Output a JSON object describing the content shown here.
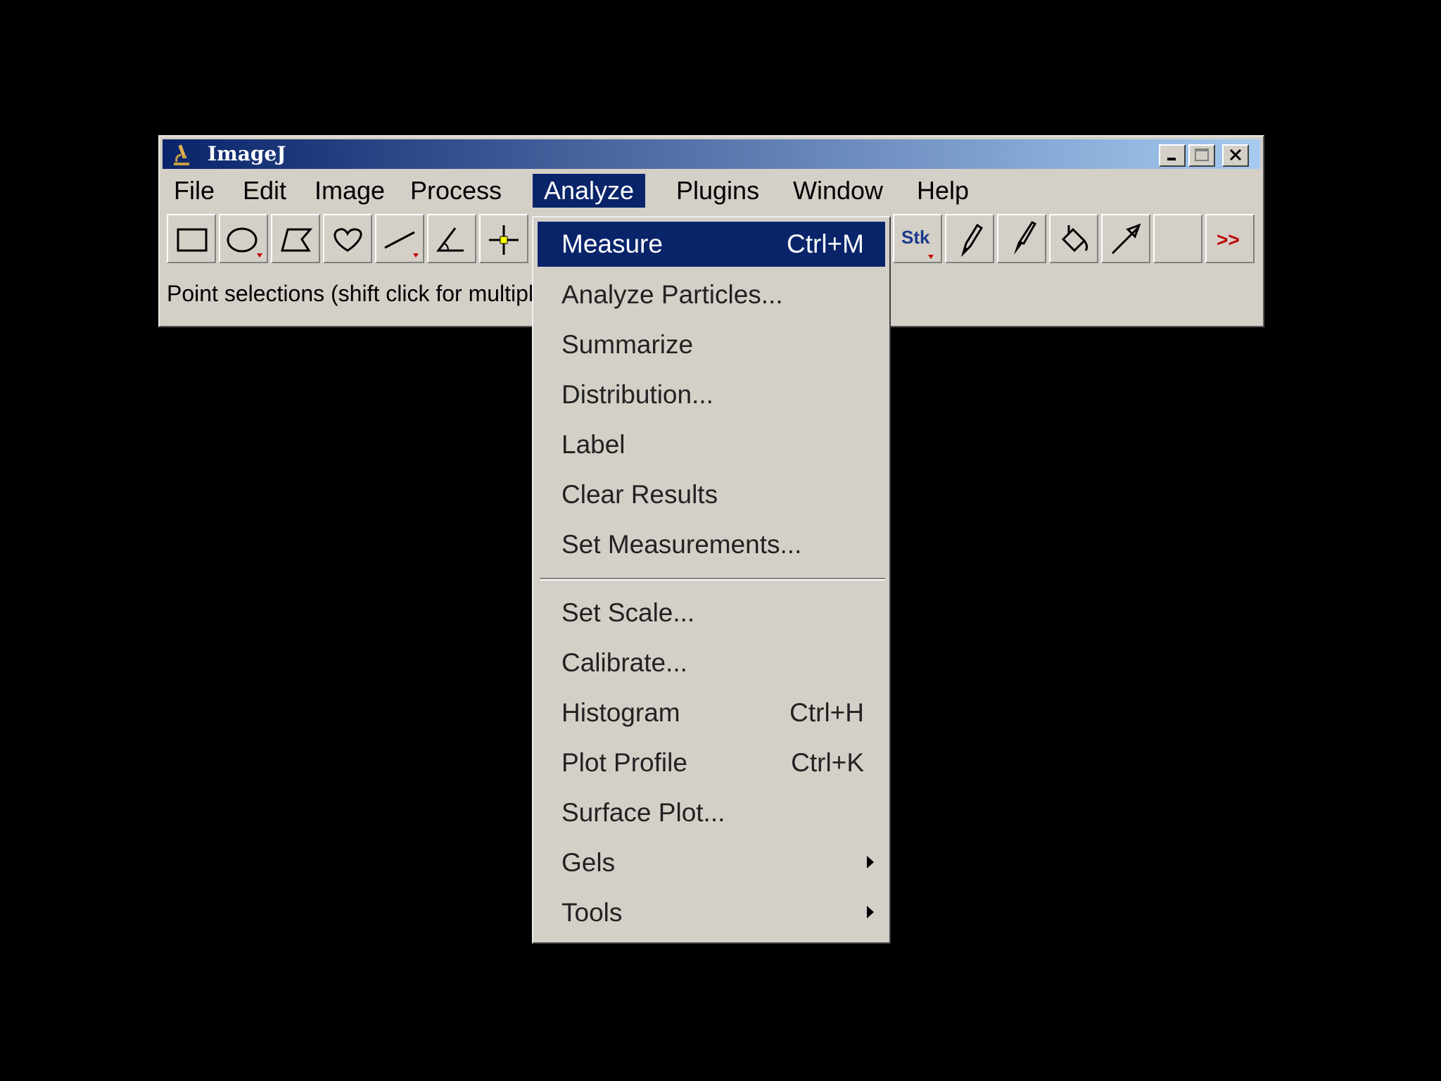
{
  "window": {
    "title": "ImageJ",
    "title_icon": "microscope-icon",
    "controls": [
      "minimize-icon",
      "maximize-icon",
      "close-icon"
    ]
  },
  "menubar": {
    "items": [
      "File",
      "Edit",
      "Image",
      "Process",
      "Analyze",
      "Plugins",
      "Window",
      "Help"
    ],
    "active": "Analyze"
  },
  "toolbar": {
    "tools": [
      "rectangle-tool-icon",
      "oval-tool-icon",
      "polygon-tool-icon",
      "freehand-tool-icon",
      "line-tool-icon",
      "angle-tool-icon",
      "point-tool-icon"
    ],
    "right_tools": [
      "stk-tool-icon",
      "pencil-tool-icon",
      "brush-tool-icon",
      "flood-fill-tool-icon",
      "arrow-tool-icon",
      "empty-slot",
      "more-tools-icon"
    ],
    "stk_label": "Stk",
    "more_label": ">>"
  },
  "status_text": "Point selections (shift click for multiple points)",
  "analyze_menu": {
    "items": [
      {
        "label": "Measure",
        "shortcut": "Ctrl+M",
        "highlighted": true
      },
      {
        "label": "Analyze Particles...",
        "shortcut": ""
      },
      {
        "label": "Summarize",
        "shortcut": ""
      },
      {
        "label": "Distribution...",
        "shortcut": ""
      },
      {
        "label": "Label",
        "shortcut": ""
      },
      {
        "label": "Clear Results",
        "shortcut": ""
      },
      {
        "label": "Set Measurements...",
        "shortcut": ""
      },
      {
        "label": "Set Scale...",
        "shortcut": ""
      },
      {
        "label": "Calibrate...",
        "shortcut": ""
      },
      {
        "label": "Histogram",
        "shortcut": "Ctrl+H"
      },
      {
        "label": "Plot Profile",
        "shortcut": "Ctrl+K"
      },
      {
        "label": "Surface Plot...",
        "shortcut": ""
      },
      {
        "label": "Gels",
        "shortcut": "",
        "submenu": true
      },
      {
        "label": "Tools",
        "shortcut": "",
        "submenu": true
      }
    ]
  },
  "colors": {
    "highlight": "#0a246a",
    "menu_bg": "#d4d0c8",
    "more_tools": "#c00000"
  }
}
